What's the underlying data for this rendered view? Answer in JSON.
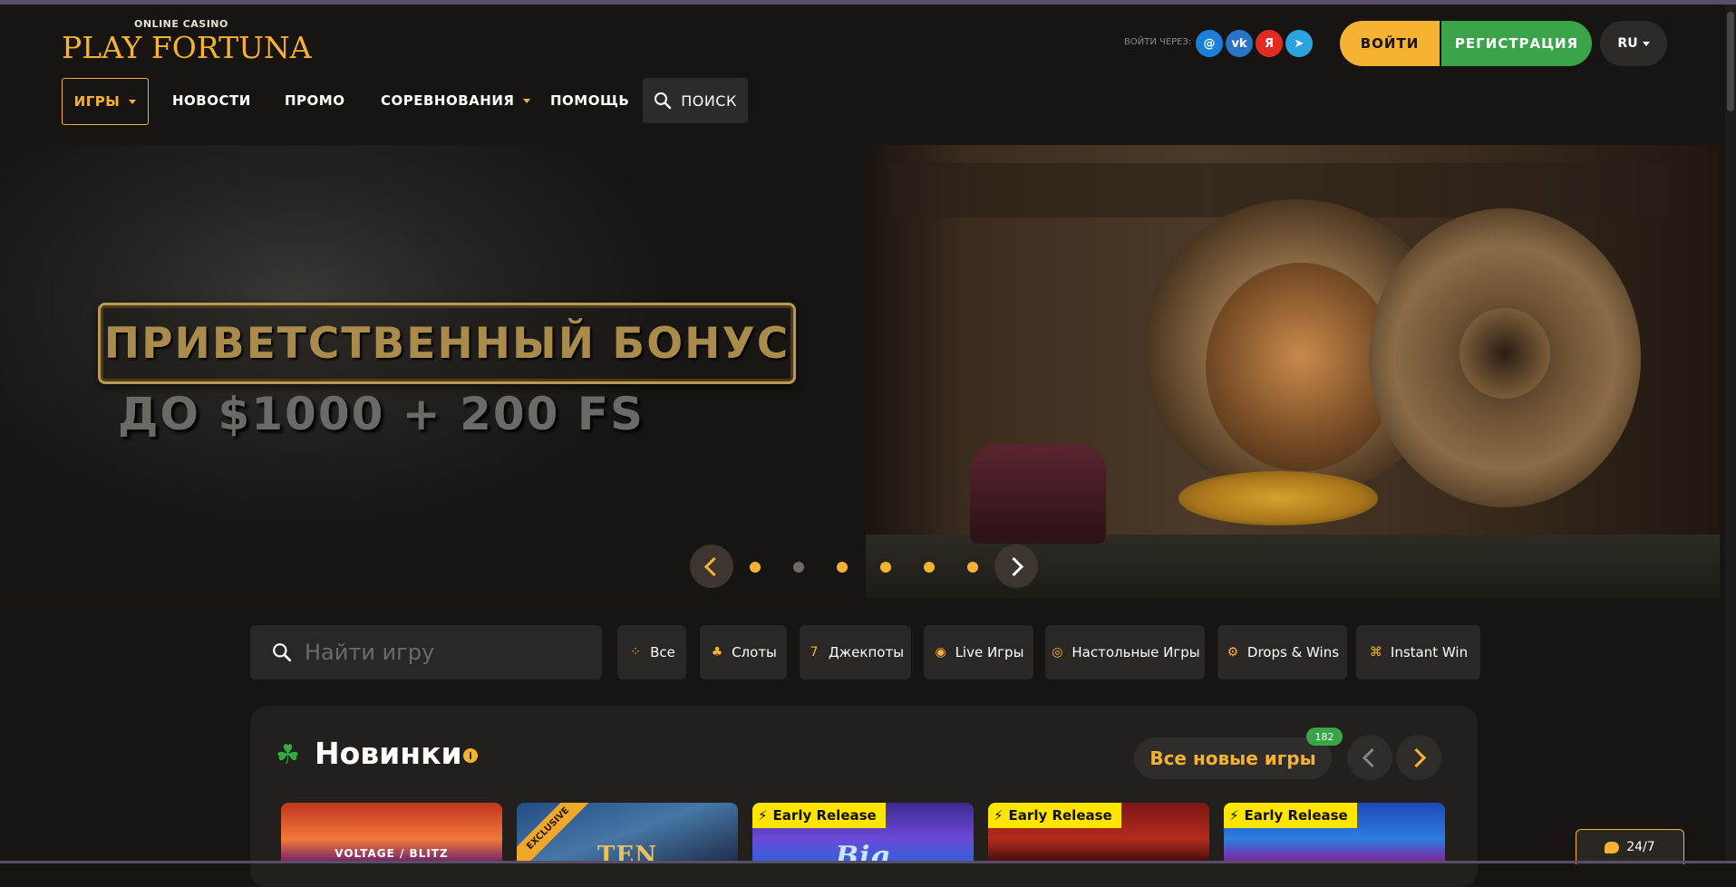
{
  "header": {
    "logo_sub": "ONLINE CASINO",
    "logo": "PLAY FORTUNA",
    "social_label": "ВОЙТИ ЧЕРЕЗ:",
    "social": [
      {
        "name": "mail-icon",
        "glyph": "@"
      },
      {
        "name": "vk-icon",
        "glyph": "vk"
      },
      {
        "name": "yandex-icon",
        "glyph": "Я"
      },
      {
        "name": "telegram-icon",
        "glyph": "➤"
      }
    ],
    "login_label": "ВОЙТИ",
    "register_label": "РЕГИСТРАЦИЯ",
    "language": "RU"
  },
  "nav": {
    "games": "ИГРЫ",
    "news": "НОВОСТИ",
    "promo": "ПРОМО",
    "competitions": "СОРЕВНОВАНИЯ",
    "help": "ПОМОЩЬ",
    "search": "ПОИСК"
  },
  "hero": {
    "title": "ПРИВЕТСТВЕННЫЙ БОНУС",
    "subtitle": "ДО $1000 + 200 FS",
    "active_slide": 2,
    "slide_count": 6
  },
  "filters": {
    "search_placeholder": "Найти игру",
    "categories": [
      {
        "label": "Все",
        "icon": "all-icon"
      },
      {
        "label": "Слоты",
        "icon": "cherry-icon"
      },
      {
        "label": "Джекпоты",
        "icon": "jackpot-icon"
      },
      {
        "label": "Live Игры",
        "icon": "live-icon"
      },
      {
        "label": "Настольные Игры",
        "icon": "chip-icon"
      },
      {
        "label": "Drops & Wins",
        "icon": "drops-icon"
      },
      {
        "label": "Instant Win",
        "icon": "gamepad-icon"
      }
    ]
  },
  "new_games": {
    "title": "Новинки",
    "all_label": "Все новые игры",
    "count": "182",
    "tiles": [
      {
        "text": "VOLTAGE / BLITZ",
        "tag": ""
      },
      {
        "text": "TEN",
        "tag": "EXCLUSIVE"
      },
      {
        "text": "Big",
        "tag": "Early Release"
      },
      {
        "text": "",
        "tag": "Early Release"
      },
      {
        "text": "",
        "tag": "Early Release"
      }
    ]
  },
  "support": {
    "label": "24/7"
  },
  "colors": {
    "accent": "#f6b232",
    "register": "#3aa548",
    "background": "#171412",
    "early_release": "#ffe500"
  }
}
